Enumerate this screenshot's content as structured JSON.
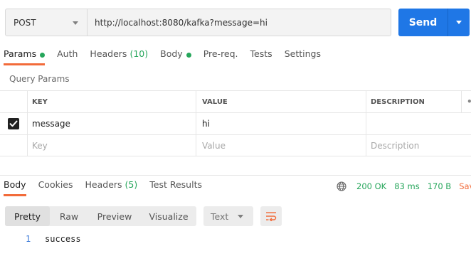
{
  "request": {
    "method": "POST",
    "url": "http://localhost:8080/kafka?message=hi",
    "send_label": "Send"
  },
  "request_tabs": [
    {
      "label": "Params",
      "active": true,
      "dot": true
    },
    {
      "label": "Auth"
    },
    {
      "label": "Headers",
      "count": "(10)"
    },
    {
      "label": "Body",
      "dot": true
    },
    {
      "label": "Pre-req."
    },
    {
      "label": "Tests"
    },
    {
      "label": "Settings"
    }
  ],
  "query_params": {
    "title": "Query Params",
    "headers": [
      "KEY",
      "VALUE",
      "DESCRIPTION"
    ],
    "more": "•••",
    "rows": [
      {
        "checked": true,
        "key": "message",
        "value": "hi",
        "description": ""
      }
    ],
    "placeholders": {
      "key": "Key",
      "value": "Value",
      "description": "Description"
    }
  },
  "response_tabs": [
    {
      "label": "Body",
      "active": true
    },
    {
      "label": "Cookies"
    },
    {
      "label": "Headers",
      "count": "(5)"
    },
    {
      "label": "Test Results"
    }
  ],
  "response_status": {
    "icon": "globe-icon",
    "status": "200 OK",
    "time": "83 ms",
    "size": "170 B",
    "save": "Sav"
  },
  "format_tabs": [
    "Pretty",
    "Raw",
    "Preview",
    "Visualize"
  ],
  "format_active": "Pretty",
  "language": "Text",
  "wrap_icon": "wrap-lines-icon",
  "code_lines": [
    {
      "num": "1",
      "text": "success"
    }
  ],
  "colors": {
    "accent": "#f26b3a",
    "send": "#1f77e6",
    "success": "#26a65b",
    "line_number": "#3d7bd9"
  }
}
